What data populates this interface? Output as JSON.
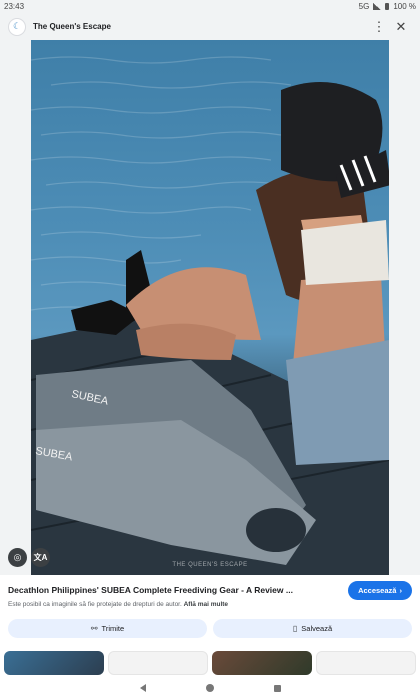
{
  "status_bar": {
    "time": "23:43",
    "network": "5G",
    "battery": "100 %"
  },
  "header": {
    "site_title": "The Queen's Escape",
    "menu_icon": "more-vert-icon",
    "close_icon": "close-icon"
  },
  "image": {
    "watermark": "THE QUEEN'S ESCAPE",
    "lens_icon": "lens-icon",
    "translate_icon": "translate-icon",
    "translate_glyph": "文A"
  },
  "result": {
    "title": "Decathlon Philippines' SUBEA Complete Freediving Gear - A Review ...",
    "visit_label": "Accesează",
    "copyright_text": "Este posibil ca imaginile să fie protejate de drepturi de autor.",
    "learn_more": "Află mai multe"
  },
  "actions": {
    "share_label": "Trimite",
    "save_label": "Salvează"
  },
  "colors": {
    "accent": "#1a73e8",
    "pill_bg": "#e8f0fe",
    "water": "#4d8db6"
  }
}
